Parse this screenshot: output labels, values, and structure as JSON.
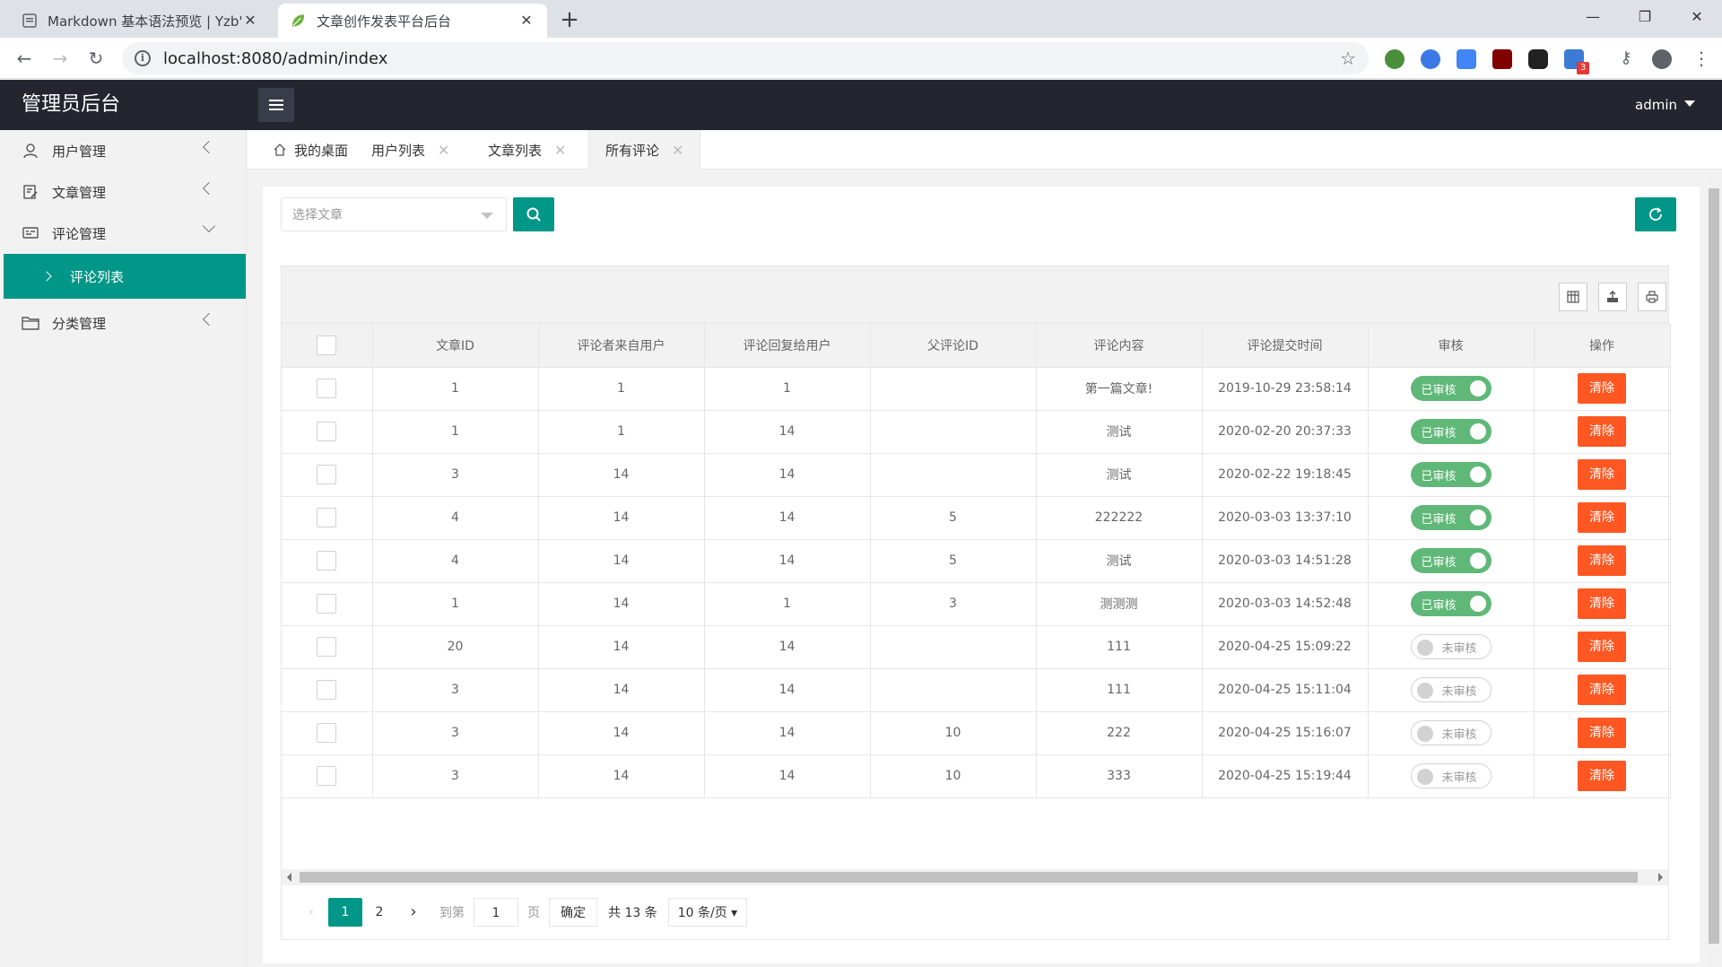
{
  "browser": {
    "tabs": [
      {
        "title": "Markdown 基本语法预览 | Yzb'"
      },
      {
        "title": "文章创作发表平台后台"
      }
    ],
    "url": "localhost:8080/admin/index",
    "ext_badge": "3"
  },
  "header": {
    "title": "管理员后台",
    "user": "admin"
  },
  "sidebar": {
    "items": [
      {
        "label": "用户管理"
      },
      {
        "label": "文章管理"
      },
      {
        "label": "评论管理"
      },
      {
        "label": "分类管理"
      }
    ],
    "sub_active": "评论列表"
  },
  "content_tabs": [
    {
      "label": "我的桌面"
    },
    {
      "label": "用户列表"
    },
    {
      "label": "文章列表"
    },
    {
      "label": "所有评论"
    }
  ],
  "filter": {
    "placeholder": "选择文章"
  },
  "table": {
    "columns": [
      "文章ID",
      "评论者来自用户",
      "评论回复给用户",
      "父评论ID",
      "评论内容",
      "评论提交时间",
      "审核",
      "操作"
    ],
    "status_on": "已审核",
    "status_off": "未审核",
    "delete_label": "清除",
    "rows": [
      {
        "article_id": "1",
        "from_user": "1",
        "to_user": "1",
        "parent_id": "",
        "content": "第一篇文章!",
        "time": "2019-10-29 23:58:14",
        "approved": true
      },
      {
        "article_id": "1",
        "from_user": "1",
        "to_user": "14",
        "parent_id": "",
        "content": "测试",
        "time": "2020-02-20 20:37:33",
        "approved": true
      },
      {
        "article_id": "3",
        "from_user": "14",
        "to_user": "14",
        "parent_id": "",
        "content": "测试",
        "time": "2020-02-22 19:18:45",
        "approved": true
      },
      {
        "article_id": "4",
        "from_user": "14",
        "to_user": "14",
        "parent_id": "5",
        "content": "222222",
        "time": "2020-03-03 13:37:10",
        "approved": true
      },
      {
        "article_id": "4",
        "from_user": "14",
        "to_user": "14",
        "parent_id": "5",
        "content": "测试",
        "time": "2020-03-03 14:51:28",
        "approved": true
      },
      {
        "article_id": "1",
        "from_user": "14",
        "to_user": "1",
        "parent_id": "3",
        "content": "测测测",
        "time": "2020-03-03 14:52:48",
        "approved": true
      },
      {
        "article_id": "20",
        "from_user": "14",
        "to_user": "14",
        "parent_id": "",
        "content": "111",
        "time": "2020-04-25 15:09:22",
        "approved": false
      },
      {
        "article_id": "3",
        "from_user": "14",
        "to_user": "14",
        "parent_id": "",
        "content": "111",
        "time": "2020-04-25 15:11:04",
        "approved": false
      },
      {
        "article_id": "3",
        "from_user": "14",
        "to_user": "14",
        "parent_id": "10",
        "content": "222",
        "time": "2020-04-25 15:16:07",
        "approved": false
      },
      {
        "article_id": "3",
        "from_user": "14",
        "to_user": "14",
        "parent_id": "10",
        "content": "333",
        "time": "2020-04-25 15:19:44",
        "approved": false
      }
    ]
  },
  "pager": {
    "pages": [
      "1",
      "2"
    ],
    "current": "1",
    "goto_label": "到第",
    "goto_value": "1",
    "page_unit": "页",
    "confirm_label": "确定",
    "total_label": "共 13 条",
    "limit_label": "10 条/页"
  }
}
